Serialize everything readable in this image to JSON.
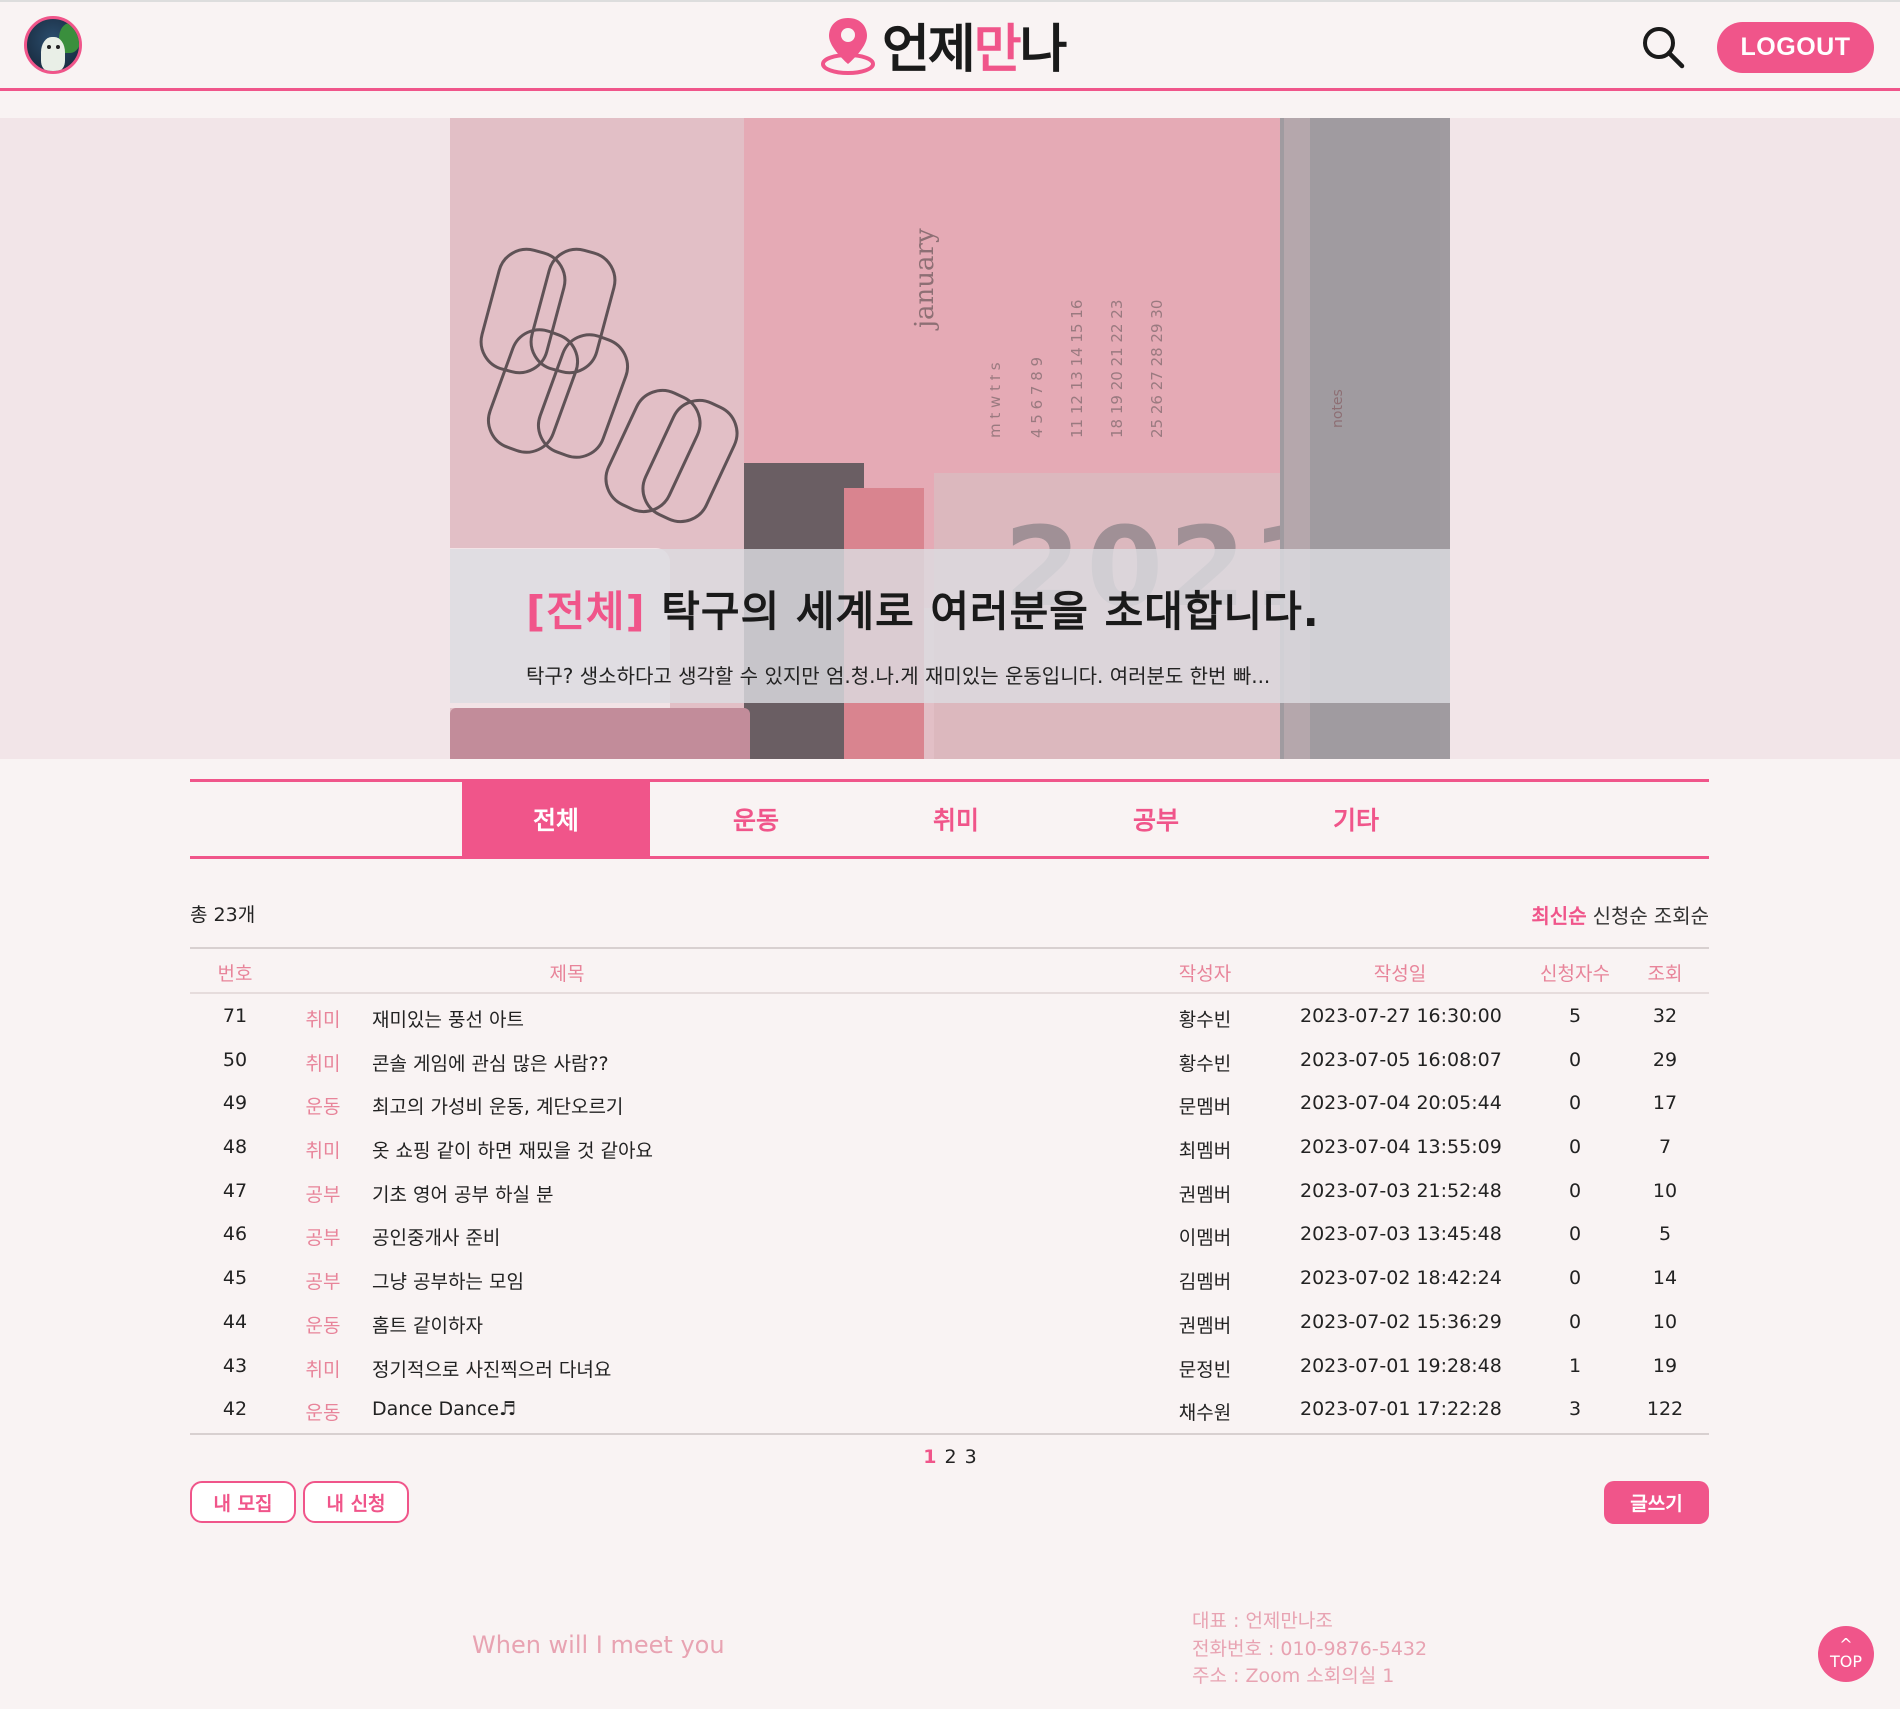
{
  "header": {
    "logo_text_1": "언제",
    "logo_text_2": "만",
    "logo_text_3": "나",
    "logout_label": "LOGOUT",
    "icons": {
      "search": "search-icon",
      "avatar": "user-avatar",
      "pin": "map-pin-icon"
    }
  },
  "hero": {
    "category": "[전체]",
    "title": "탁구의 세계로 여러분을 초대합니다.",
    "description": "탁구? 생소하다고 생각할 수 있지만  엄.청.나.게 재미있는 운동입니다. 여러분도 한번 빠..."
  },
  "tabs": [
    "전체",
    "운동",
    "취미",
    "공부",
    "기타"
  ],
  "active_tab": "전체",
  "list": {
    "total": "총 23개",
    "sort_options": [
      "최신순",
      "신청순",
      "조회순"
    ],
    "active_sort": "최신순",
    "columns": [
      "번호",
      "제목",
      "작성자",
      "작성일",
      "신청자수",
      "조회"
    ],
    "rows": [
      {
        "num": "71",
        "cat": "취미",
        "title": "재미있는 풍선 아트",
        "author": "황수빈",
        "date": "2023-07-27 16:30:00",
        "applicants": "5",
        "views": "32"
      },
      {
        "num": "50",
        "cat": "취미",
        "title": "콘솔 게임에 관심 많은 사람??",
        "author": "황수빈",
        "date": "2023-07-05 16:08:07",
        "applicants": "0",
        "views": "29"
      },
      {
        "num": "49",
        "cat": "운동",
        "title": "최고의 가성비 운동, 계단오르기",
        "author": "문멤버",
        "date": "2023-07-04 20:05:44",
        "applicants": "0",
        "views": "17"
      },
      {
        "num": "48",
        "cat": "취미",
        "title": "옷 쇼핑 같이 하면 재밌을 것 같아요",
        "author": "최멤버",
        "date": "2023-07-04 13:55:09",
        "applicants": "0",
        "views": "7"
      },
      {
        "num": "47",
        "cat": "공부",
        "title": "기초 영어 공부 하실 분",
        "author": "권멤버",
        "date": "2023-07-03 21:52:48",
        "applicants": "0",
        "views": "10"
      },
      {
        "num": "46",
        "cat": "공부",
        "title": "공인중개사 준비",
        "author": "이멤버",
        "date": "2023-07-03 13:45:48",
        "applicants": "0",
        "views": "5"
      },
      {
        "num": "45",
        "cat": "공부",
        "title": "그냥 공부하는 모임",
        "author": "김멤버",
        "date": "2023-07-02 18:42:24",
        "applicants": "0",
        "views": "14"
      },
      {
        "num": "44",
        "cat": "운동",
        "title": "홈트 같이하자",
        "author": "권멤버",
        "date": "2023-07-02 15:36:29",
        "applicants": "0",
        "views": "10"
      },
      {
        "num": "43",
        "cat": "취미",
        "title": "정기적으로 사진찍으러 다녀요",
        "author": "문정빈",
        "date": "2023-07-01 19:28:48",
        "applicants": "1",
        "views": "19"
      },
      {
        "num": "42",
        "cat": "운동",
        "title": "Dance Dance♬",
        "author": "채수원",
        "date": "2023-07-01 17:22:28",
        "applicants": "3",
        "views": "122"
      }
    ]
  },
  "pagination": {
    "pages": [
      "1",
      "2",
      "3"
    ],
    "current": "1"
  },
  "buttons": {
    "my_recruit": "내 모집",
    "my_apply": "내 신청",
    "write": "글쓰기"
  },
  "footer": {
    "slogan": "When will I meet you",
    "rep": "대표 : 언제만나조",
    "phone": "전화번호 : 010-9876-5432",
    "address": "주소 : Zoom 소회의실 1",
    "top_arrow": "^",
    "top_label": "TOP"
  },
  "colors": {
    "accent": "#f0558a",
    "accent_light": "#e8849a",
    "background": "#f9f3f3"
  }
}
